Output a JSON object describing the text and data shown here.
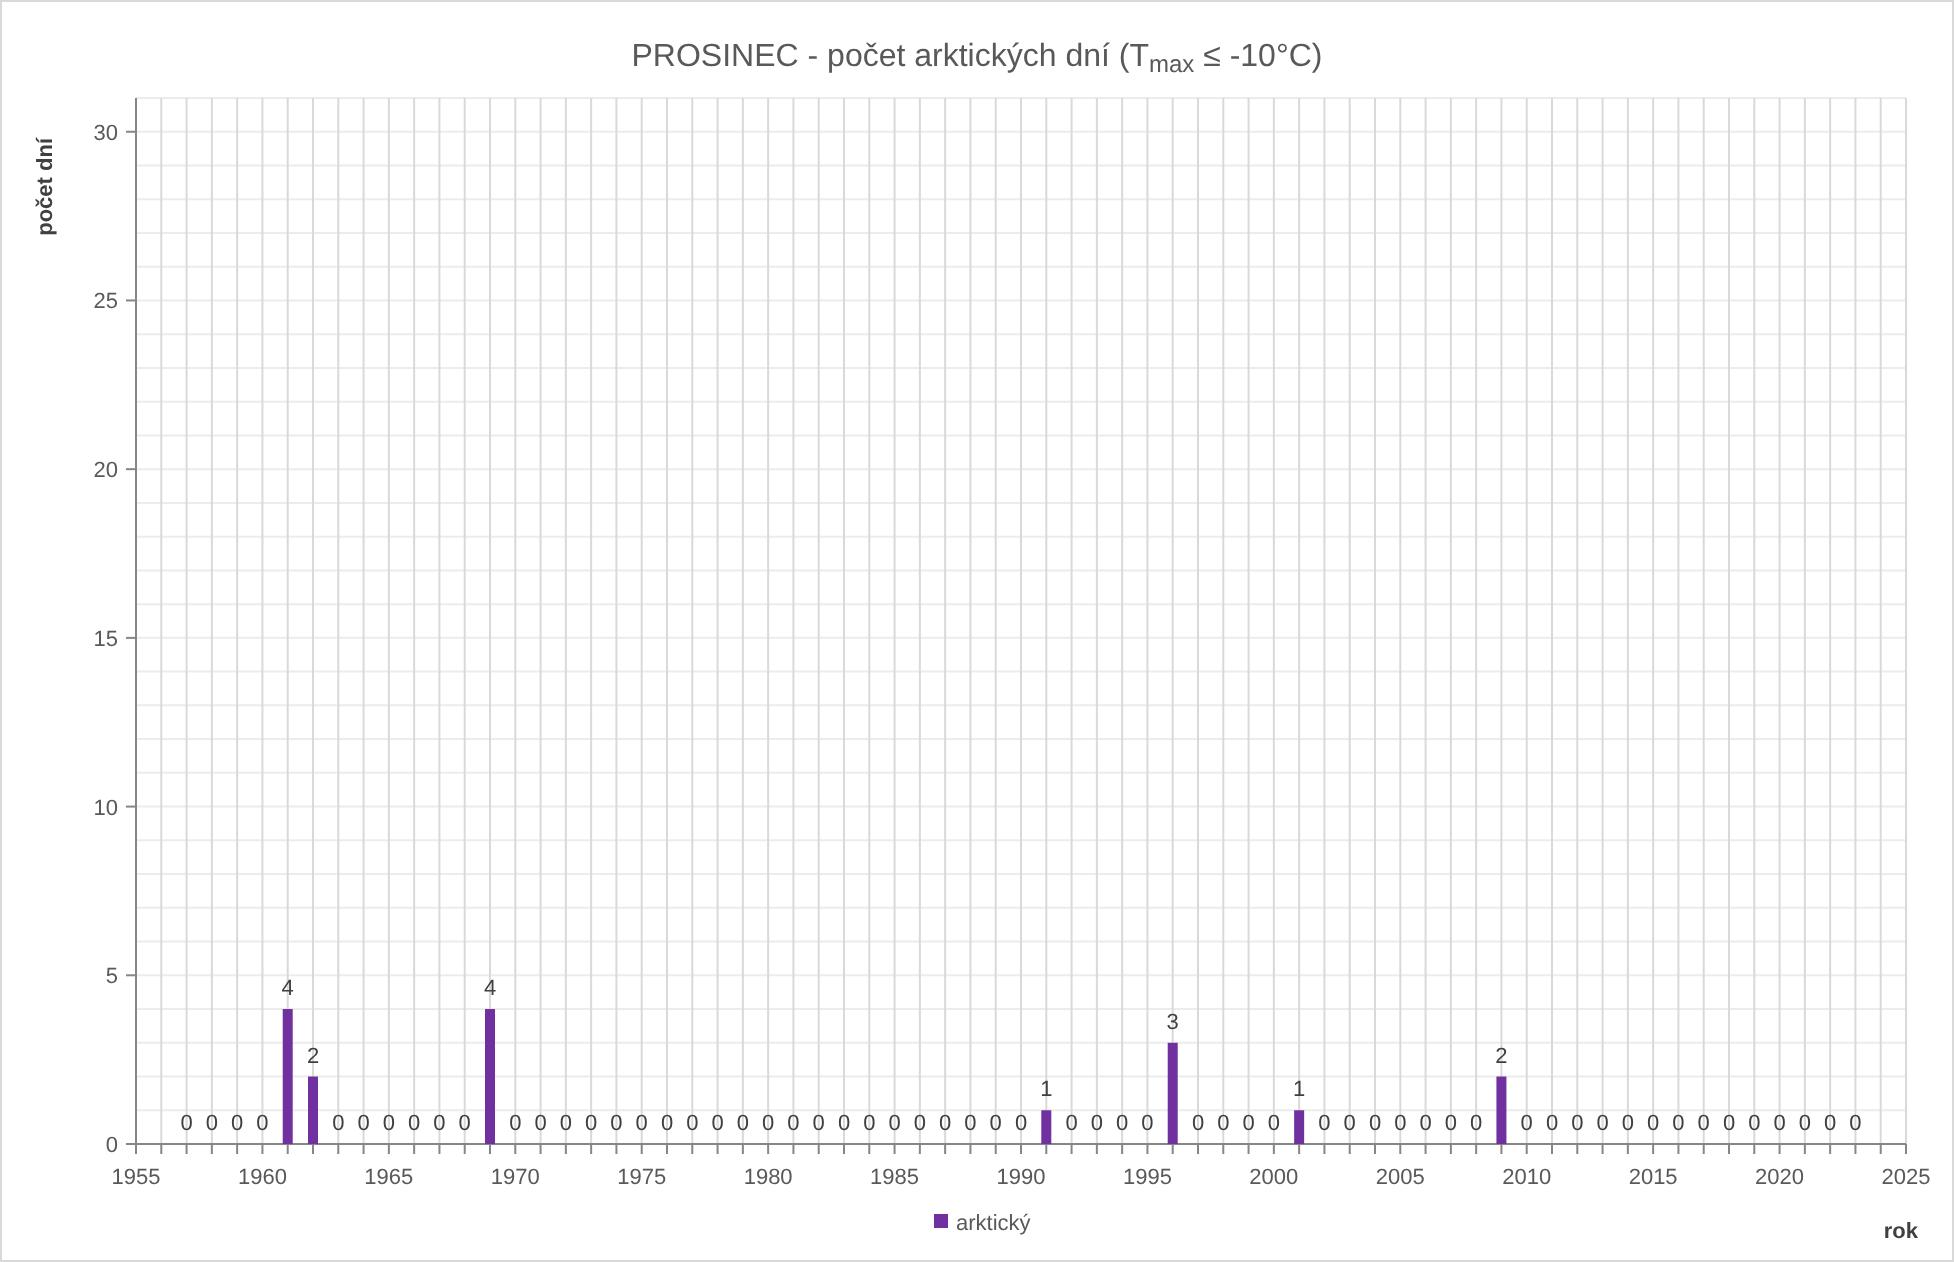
{
  "chart_data": {
    "type": "bar",
    "title": "PROSINEC - počet arktických dní (T$_{max}$ ≤ -10°C)",
    "xlabel": "rok",
    "ylabel": "počet dní",
    "x": [
      1957,
      1958,
      1959,
      1960,
      1961,
      1962,
      1963,
      1964,
      1965,
      1966,
      1967,
      1968,
      1969,
      1970,
      1971,
      1972,
      1973,
      1974,
      1975,
      1976,
      1977,
      1978,
      1979,
      1980,
      1981,
      1982,
      1983,
      1984,
      1985,
      1986,
      1987,
      1988,
      1989,
      1990,
      1991,
      1992,
      1993,
      1994,
      1995,
      1996,
      1997,
      1998,
      1999,
      2000,
      2001,
      2002,
      2003,
      2004,
      2005,
      2006,
      2007,
      2008,
      2009,
      2010,
      2011,
      2012,
      2013,
      2014,
      2015,
      2016,
      2017,
      2018,
      2019,
      2020,
      2021,
      2022,
      2023
    ],
    "series": [
      {
        "name": "arktický",
        "color": "#7030a0",
        "values": [
          0,
          0,
          0,
          0,
          4,
          2,
          0,
          0,
          0,
          0,
          0,
          0,
          4,
          0,
          0,
          0,
          0,
          0,
          0,
          0,
          0,
          0,
          0,
          0,
          0,
          0,
          0,
          0,
          0,
          0,
          0,
          0,
          0,
          0,
          1,
          0,
          0,
          0,
          0,
          3,
          0,
          0,
          0,
          0,
          1,
          0,
          0,
          0,
          0,
          0,
          0,
          0,
          2,
          0,
          0,
          0,
          0,
          0,
          0,
          0,
          0,
          0,
          0,
          0,
          0,
          0,
          0
        ]
      }
    ],
    "xlim": [
      1955,
      2025
    ],
    "ylim": [
      0,
      31
    ],
    "xticks": [
      1955,
      1960,
      1965,
      1970,
      1975,
      1980,
      1985,
      1990,
      1995,
      2000,
      2005,
      2010,
      2015,
      2020,
      2025
    ],
    "yticks": [
      0,
      5,
      10,
      15,
      20,
      25,
      30
    ],
    "data_labels": true,
    "grid": true
  }
}
